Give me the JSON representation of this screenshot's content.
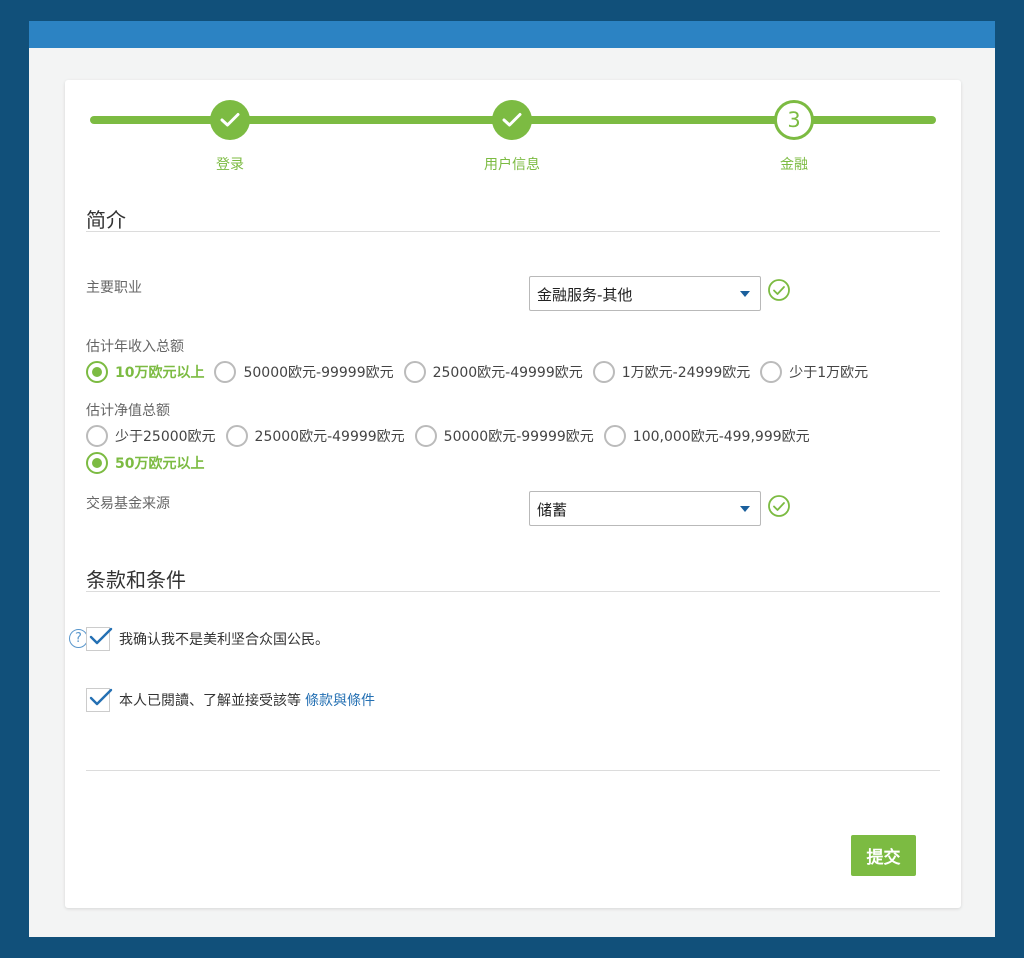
{
  "steps": [
    {
      "label": "登录",
      "status": "done"
    },
    {
      "label": "用户信息",
      "status": "done"
    },
    {
      "label": "金融",
      "status": "current",
      "number": "3"
    }
  ],
  "profile": {
    "title": "简介",
    "occupation": {
      "label": "主要职业",
      "value": "金融服务-其他"
    },
    "annual_income": {
      "label": "估计年收入总额",
      "options": [
        "10万欧元以上",
        "50000欧元-99999欧元",
        "25000欧元-49999欧元",
        "1万欧元-24999欧元",
        "少于1万欧元"
      ],
      "selected_index": 0
    },
    "net_worth": {
      "label": "估计净值总额",
      "options": [
        "少于25000欧元",
        "25000欧元-49999欧元",
        "50000欧元-99999欧元",
        "100,000欧元-499,999欧元",
        "50万欧元以上"
      ],
      "selected_index": 4
    },
    "fund_source": {
      "label": "交易基金来源",
      "value": "储蓄"
    }
  },
  "terms": {
    "title": "条款和条件",
    "us_citizen": {
      "text": "我确认我不是美利坚合众国公民。",
      "checked": true
    },
    "agreement": {
      "text": "本人已閱讀、了解並接受該等",
      "link": "條款與條件",
      "checked": true
    }
  },
  "submit_label": "提交",
  "colors": {
    "accent": "#7cbb42",
    "topbar": "#2c83c3",
    "background": "#11507a",
    "link": "#2470b3"
  }
}
